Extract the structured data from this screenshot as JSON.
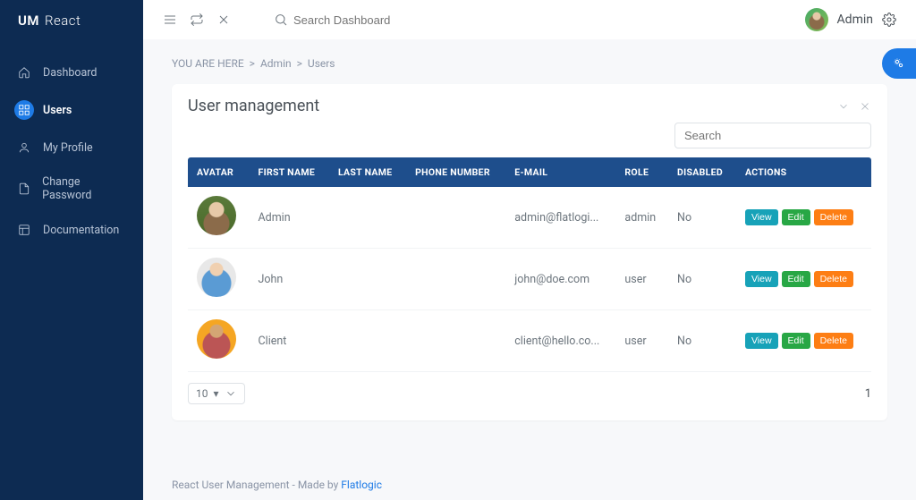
{
  "brand": {
    "bold": "UM",
    "light": "React"
  },
  "sidebar": {
    "items": [
      {
        "label": "Dashboard",
        "icon": "home"
      },
      {
        "label": "Users",
        "icon": "grid",
        "active": true
      },
      {
        "label": "My Profile",
        "icon": "user"
      },
      {
        "label": "Change Password",
        "icon": "file"
      },
      {
        "label": "Documentation",
        "icon": "layout"
      }
    ]
  },
  "topbar": {
    "search_placeholder": "Search Dashboard",
    "user_name": "Admin"
  },
  "breadcrumb": {
    "prefix": "YOU ARE HERE",
    "sep": ">",
    "items": [
      "Admin",
      "Users"
    ]
  },
  "panel": {
    "title": "User management",
    "search_placeholder": "Search"
  },
  "table": {
    "headers": [
      "AVATAR",
      "FIRST NAME",
      "LAST NAME",
      "PHONE NUMBER",
      "E-MAIL",
      "ROLE",
      "DISABLED",
      "ACTIONS"
    ],
    "rows": [
      {
        "avatar": "av-admin",
        "first": "Admin",
        "last": "",
        "phone": "",
        "email": "admin@flatlogi...",
        "role": "admin",
        "disabled": "No"
      },
      {
        "avatar": "av-john",
        "first": "John",
        "last": "",
        "phone": "",
        "email": "john@doe.com",
        "role": "user",
        "disabled": "No"
      },
      {
        "avatar": "av-client",
        "first": "Client",
        "last": "",
        "phone": "",
        "email": "client@hello.co...",
        "role": "user",
        "disabled": "No"
      }
    ],
    "actions": {
      "view": "View",
      "edit": "Edit",
      "delete": "Delete"
    },
    "page_size": "10",
    "page_number": "1"
  },
  "footer": {
    "text": "React User Management - Made by ",
    "link": "Flatlogic"
  }
}
